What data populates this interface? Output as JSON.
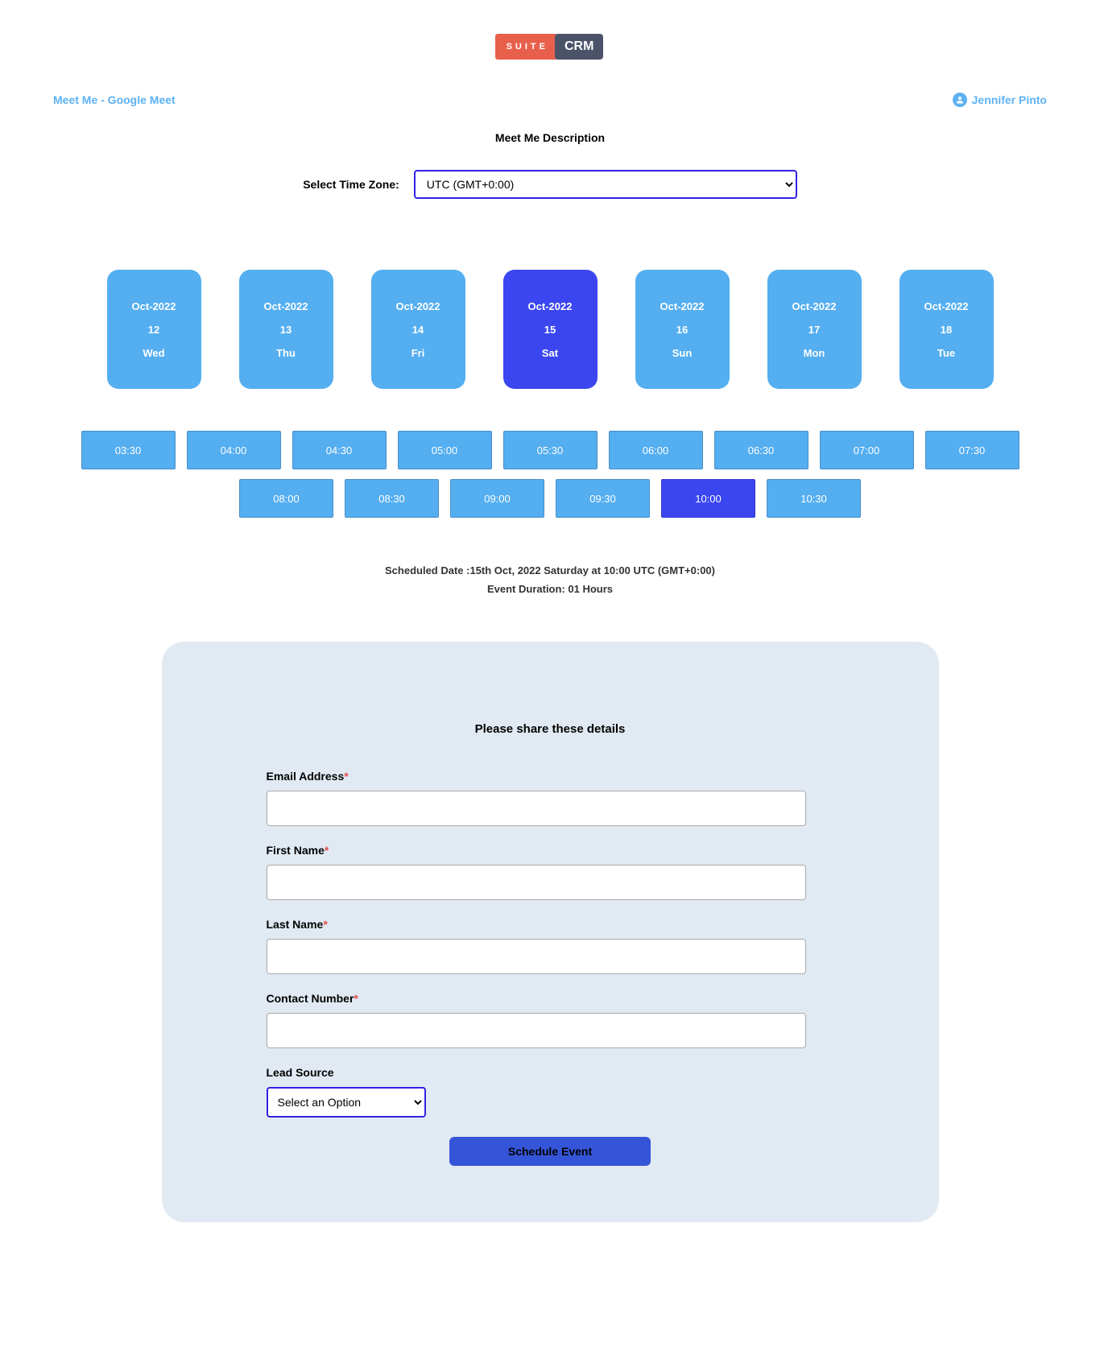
{
  "logo": {
    "left": "SUITE",
    "right": "CRM"
  },
  "header": {
    "left_link": "Meet Me - Google Meet",
    "user_name": "Jennifer Pinto"
  },
  "description": "Meet Me Description",
  "timezone": {
    "label": "Select Time Zone:",
    "selected": "UTC (GMT+0:00)"
  },
  "dates": [
    {
      "month": "Oct-2022",
      "day": "12",
      "dow": "Wed",
      "selected": false
    },
    {
      "month": "Oct-2022",
      "day": "13",
      "dow": "Thu",
      "selected": false
    },
    {
      "month": "Oct-2022",
      "day": "14",
      "dow": "Fri",
      "selected": false
    },
    {
      "month": "Oct-2022",
      "day": "15",
      "dow": "Sat",
      "selected": true
    },
    {
      "month": "Oct-2022",
      "day": "16",
      "dow": "Sun",
      "selected": false
    },
    {
      "month": "Oct-2022",
      "day": "17",
      "dow": "Mon",
      "selected": false
    },
    {
      "month": "Oct-2022",
      "day": "18",
      "dow": "Tue",
      "selected": false
    }
  ],
  "times_row1": [
    {
      "t": "03:30",
      "selected": false
    },
    {
      "t": "04:00",
      "selected": false
    },
    {
      "t": "04:30",
      "selected": false
    },
    {
      "t": "05:00",
      "selected": false
    },
    {
      "t": "05:30",
      "selected": false
    },
    {
      "t": "06:00",
      "selected": false
    },
    {
      "t": "06:30",
      "selected": false
    },
    {
      "t": "07:00",
      "selected": false
    },
    {
      "t": "07:30",
      "selected": false
    }
  ],
  "times_row2": [
    {
      "t": "08:00",
      "selected": false
    },
    {
      "t": "08:30",
      "selected": false
    },
    {
      "t": "09:00",
      "selected": false
    },
    {
      "t": "09:30",
      "selected": false
    },
    {
      "t": "10:00",
      "selected": true
    },
    {
      "t": "10:30",
      "selected": false
    }
  ],
  "scheduled_text": "Scheduled Date :15th Oct, 2022 Saturday at 10:00 UTC (GMT+0:00)",
  "duration_text": "Event Duration: 01 Hours",
  "form": {
    "title": "Please share these details",
    "email_label": "Email Address",
    "first_name_label": "First Name",
    "last_name_label": "Last Name",
    "contact_label": "Contact Number",
    "lead_source_label": "Lead Source",
    "lead_source_selected": "Select an Option",
    "submit_label": "Schedule Event",
    "email_value": "",
    "first_name_value": "",
    "last_name_value": "",
    "contact_value": ""
  }
}
